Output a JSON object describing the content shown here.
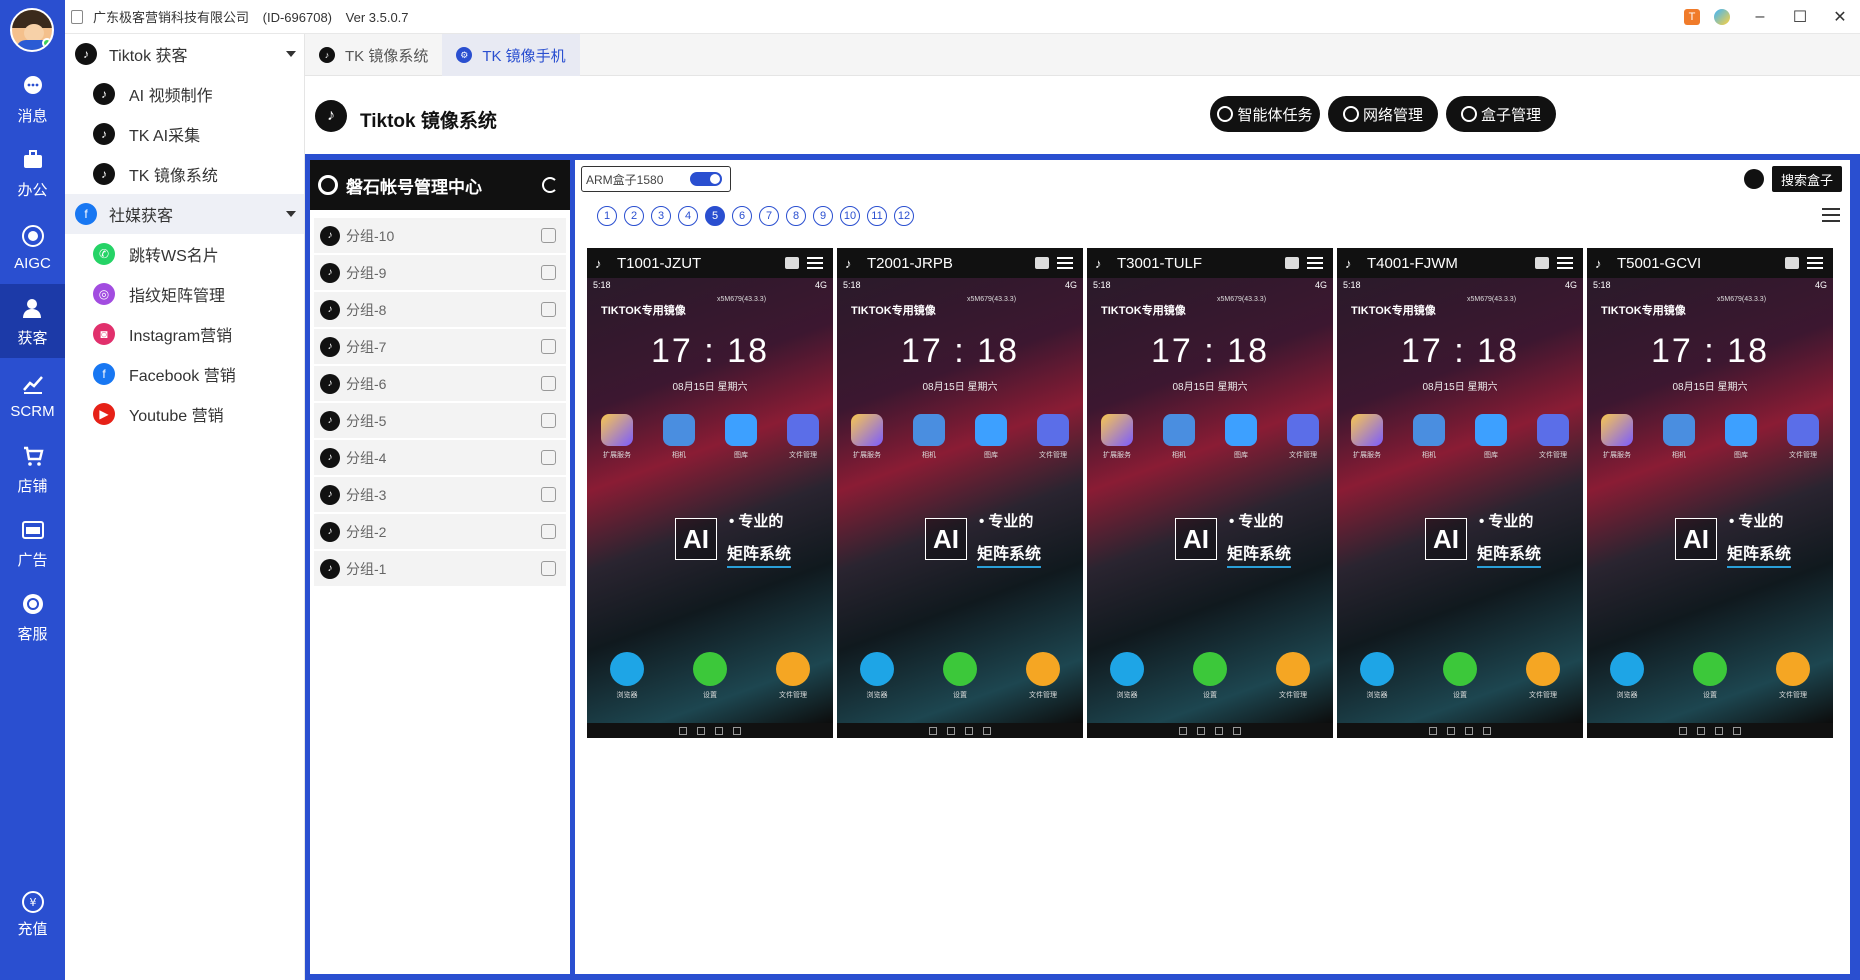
{
  "window": {
    "company": "广东极客营销科技有限公司",
    "id": "(ID-696708)",
    "version": "Ver 3.5.0.7",
    "app_badge": "T"
  },
  "rail": [
    {
      "label": "消息",
      "icon": "chat-bubble-icon"
    },
    {
      "label": "办公",
      "icon": "briefcase-icon"
    },
    {
      "label": "AIGC",
      "icon": "ai-icon"
    },
    {
      "label": "获客",
      "icon": "user-add-icon",
      "active": true
    },
    {
      "label": "SCRM",
      "icon": "chart-line-icon"
    },
    {
      "label": "店铺",
      "icon": "cart-icon"
    },
    {
      "label": "广告",
      "icon": "ads-icon"
    },
    {
      "label": "客服",
      "icon": "headset-icon"
    }
  ],
  "recharge": {
    "label": "充值",
    "icon": "yen-icon"
  },
  "menu": {
    "tiktok_group": "Tiktok 获客",
    "tiktok_items": [
      "AI 视频制作",
      "TK AI采集",
      "TK 镜像系统"
    ],
    "social_group": "社媒获客",
    "social_items": [
      "跳转WS名片",
      "指纹矩阵管理",
      "Instagram营销",
      "Facebook 营销",
      "Youtube 营销"
    ]
  },
  "tabs": [
    "TK 镜像系统",
    "TK 镜像手机"
  ],
  "header": {
    "title": "Tiktok 镜像系统",
    "buttons": [
      "智能体任务",
      "网络管理",
      "盒子管理"
    ]
  },
  "account_panel": {
    "title": "磐石帐号管理中心",
    "groups": [
      "分组-10",
      "分组-9",
      "分组-8",
      "分组-7",
      "分组-6",
      "分组-5",
      "分组-4",
      "分组-3",
      "分组-2",
      "分组-1"
    ]
  },
  "box": {
    "box_label": "ARM盒子1580",
    "search_button": "搜索盒子",
    "pages": [
      "1",
      "2",
      "3",
      "4",
      "5",
      "6",
      "7",
      "8",
      "9",
      "10",
      "11",
      "12"
    ],
    "active_page": "5"
  },
  "phone_common": {
    "time": "5:18",
    "signal": "4G",
    "model": "x5M679(43.3.3)",
    "brand": "TIKTOK专用镜像",
    "clock": "17 : 18",
    "date": "08月15日  星期六",
    "apps": [
      "扩展服务",
      "相机",
      "图库",
      "文件管理"
    ],
    "ai_logo": "AI",
    "slogan_line1": "• 专业的",
    "slogan_line2": "矩阵系统",
    "dock": [
      "浏览器",
      "设置",
      "文件管理"
    ]
  },
  "phones": [
    {
      "name": "T1001-JZUT"
    },
    {
      "name": "T2001-JRPB"
    },
    {
      "name": "T3001-TULF"
    },
    {
      "name": "T4001-FJWM"
    },
    {
      "name": "T5001-GCVI"
    }
  ],
  "colors": {
    "accent": "#2a4fd0",
    "dark": "#111111"
  }
}
